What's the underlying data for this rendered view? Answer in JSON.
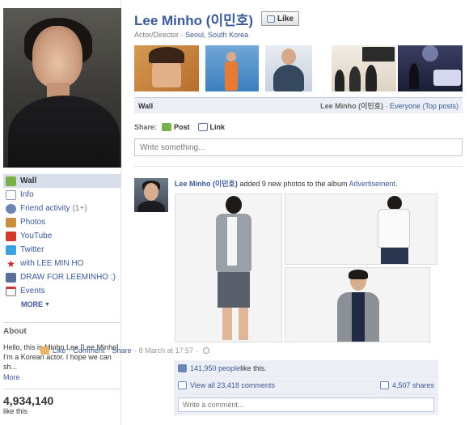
{
  "page": {
    "name": "Lee Minho (이민호)",
    "like_button": "Like",
    "category": "Actor/Director",
    "location": "Seoul, South Korea"
  },
  "left_nav": {
    "items": [
      {
        "label": "Wall",
        "icon": "wall-icon",
        "color": "#7ab04a"
      },
      {
        "label": "Info",
        "icon": "info-icon",
        "color": "#8b9ab5"
      },
      {
        "label": "Friend activity",
        "count": "(1+)",
        "icon": "friends-icon",
        "color": "#6e84b5"
      },
      {
        "label": "Photos",
        "icon": "photos-icon",
        "color": "#c98e3d"
      },
      {
        "label": "YouTube",
        "icon": "youtube-icon",
        "color": "#d33a2c"
      },
      {
        "label": "Twitter",
        "icon": "twitter-icon",
        "color": "#3ba1e0"
      },
      {
        "label": "with LEE MIN HO",
        "icon": "star-icon",
        "color": "#cc2222"
      },
      {
        "label": "DRAW FOR LEEMINHO :)",
        "icon": "app-icon",
        "color": "#5a6f99"
      },
      {
        "label": "Events",
        "icon": "calendar-icon",
        "color": "#7a7a7a"
      }
    ],
    "more": "MORE"
  },
  "about": {
    "heading": "About",
    "text": "Hello, this is Minho Lee [Lee Minho]. I'm a Korean actor. I hope we can sh...",
    "more": "More"
  },
  "likes": {
    "count": "4,934,140",
    "label": "like this"
  },
  "wall_bar": {
    "left": "Wall",
    "right_name": "Lee Minho (이민호)",
    "right_sep": " · ",
    "right_link": "Everyone (Top posts)"
  },
  "share": {
    "label": "Share:",
    "post": "Post",
    "link": "Link"
  },
  "composer": {
    "placeholder": "Write something..."
  },
  "story": {
    "actor": "Lee Minho (이민호)",
    "text": " added 9 new photos to the album ",
    "album": "Advertisement",
    "end": "."
  },
  "actions": {
    "like": "Like",
    "comment": "Comment",
    "share": "Share",
    "time": "8 March at 17:57",
    "dot": "·"
  },
  "feedback": {
    "likes_count": "141,950 people",
    "likes_suffix": " like this.",
    "view_comments": "View all 23,418 comments",
    "shares": "4,507 shares",
    "comment_placeholder": "Write a comment..."
  }
}
